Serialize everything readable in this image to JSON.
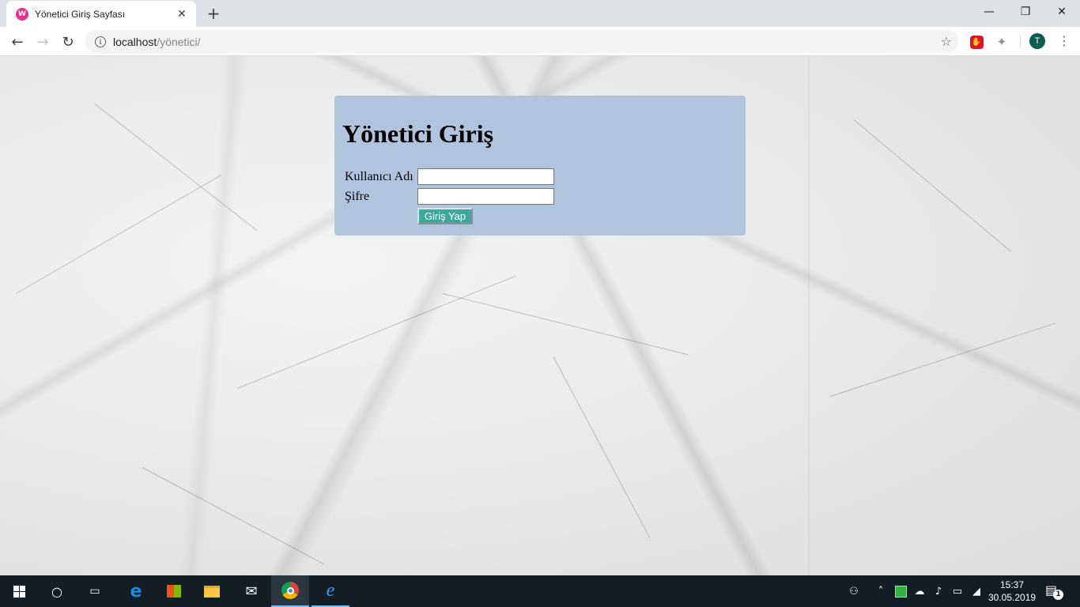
{
  "browser": {
    "tab_title": "Yönetici Giriş Sayfası",
    "favicon_letter": "W",
    "url_host": "localhost",
    "url_path": "/yönetici/",
    "avatar_letter": "T"
  },
  "login": {
    "heading": "Yönetici Giriş",
    "username_label": "Kullanıcı Adı",
    "username_value": "",
    "password_label": "Şifre",
    "password_value": "",
    "submit_label": "Giriş Yap"
  },
  "taskbar": {
    "time": "15:37",
    "date": "30.05.2019",
    "notification_count": "1"
  },
  "icons": {
    "accent": "#b0c4de",
    "button": "#3ea8a0"
  }
}
